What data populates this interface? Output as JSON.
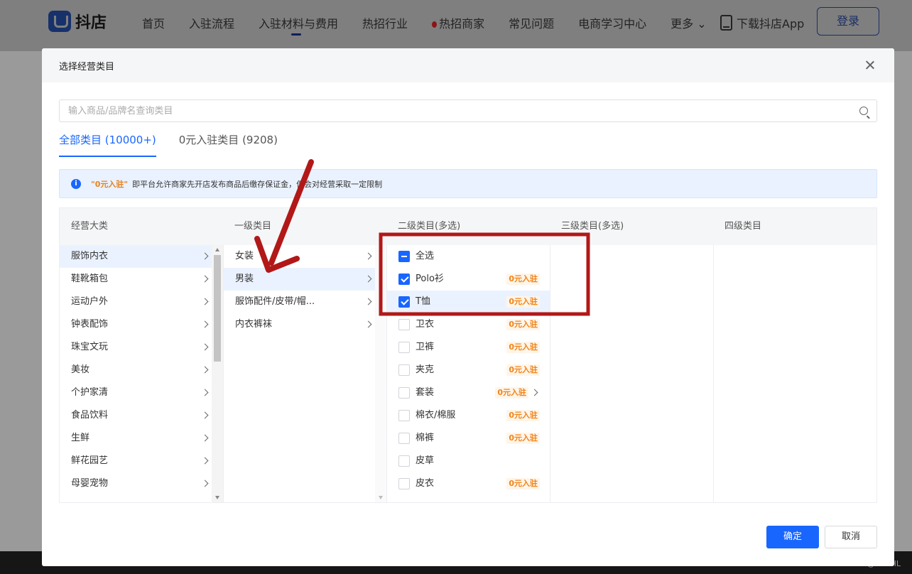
{
  "site": {
    "logo": "抖店",
    "nav": [
      "首页",
      "入驻流程",
      "入驻材料与费用",
      "热招行业",
      "热招商家",
      "常见问题",
      "电商学习中心",
      "更多"
    ],
    "download": "下载抖店App",
    "login": "登录"
  },
  "modal": {
    "title": "选择经营类目",
    "search_placeholder": "输入商品/品牌名查询类目",
    "tabs": [
      "全部类目 (10000+)",
      "0元入驻类目 (9208)"
    ],
    "notice_highlight": "\"0元入驻\"",
    "notice_text": "即平台允许商家先开店发布商品后缴存保证金，但会对经营采取一定限制",
    "headers": [
      "经营大类",
      "一级类目",
      "二级类目(多选)",
      "三级类目(多选)",
      "四级类目"
    ],
    "col1": [
      "服饰内衣",
      "鞋靴箱包",
      "运动户外",
      "钟表配饰",
      "珠宝文玩",
      "美妆",
      "个护家清",
      "食品饮料",
      "生鲜",
      "鲜花园艺",
      "母婴宠物"
    ],
    "col2": [
      "女装",
      "男装",
      "服饰配件/皮带/帽...",
      "内衣裤袜"
    ],
    "col3": [
      {
        "label": "全选",
        "state": "partial",
        "badge": ""
      },
      {
        "label": "Polo衫",
        "state": "checked",
        "badge": "0元入驻"
      },
      {
        "label": "T恤",
        "state": "checked",
        "badge": "0元入驻"
      },
      {
        "label": "卫衣",
        "state": "unchecked",
        "badge": "0元入驻"
      },
      {
        "label": "卫裤",
        "state": "unchecked",
        "badge": "0元入驻"
      },
      {
        "label": "夹克",
        "state": "unchecked",
        "badge": "0元入驻"
      },
      {
        "label": "套装",
        "state": "unchecked",
        "badge": "0元入驻",
        "has_children": true
      },
      {
        "label": "棉衣/棉服",
        "state": "unchecked",
        "badge": "0元入驻"
      },
      {
        "label": "棉裤",
        "state": "unchecked",
        "badge": "0元入驻"
      },
      {
        "label": "皮草",
        "state": "unchecked",
        "badge": ""
      },
      {
        "label": "皮衣",
        "state": "unchecked",
        "badge": "0元入驻"
      }
    ],
    "confirm": "确定",
    "cancel": "取消"
  },
  "watermark": "CSDN @DSPHL",
  "colors": {
    "accent": "#1966ff",
    "badge": "#f0841b",
    "annotation": "#b21818"
  }
}
